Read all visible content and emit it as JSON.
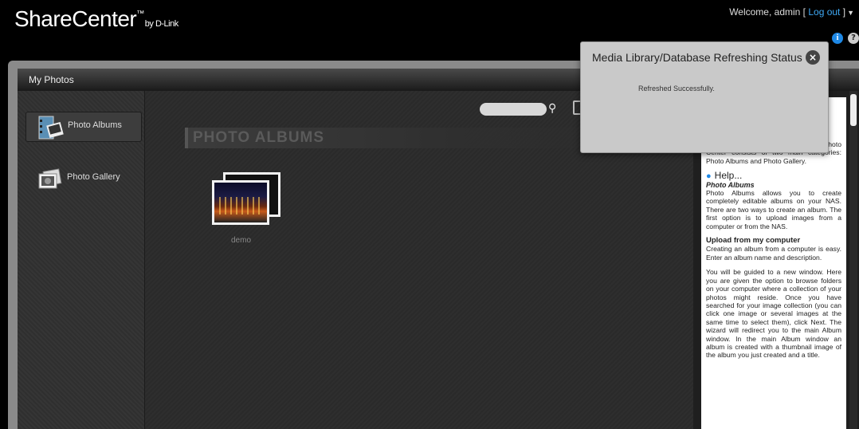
{
  "header": {
    "brand": "ShareCenter",
    "brand_tm": "™",
    "brand_by": "by D-Link",
    "welcome_text": "Welcome, admin [",
    "logout_label": "Log out",
    "welcome_end": "]",
    "info_icon": "info-icon",
    "help_icon": "help-icon"
  },
  "window": {
    "title": "My Photos"
  },
  "sidebar": {
    "items": [
      {
        "label": "Photo Albums",
        "icon": "photo-albums-icon",
        "active": true
      },
      {
        "label": "Photo Gallery",
        "icon": "photo-gallery-icon",
        "active": false
      }
    ]
  },
  "main": {
    "search_placeholder": "",
    "section_title": "PHOTO ALBUMS",
    "albums": [
      {
        "name": "demo"
      }
    ]
  },
  "help": {
    "intro_visible": "allows um on \"My e main enter. Photo Center consists of two main categories: Photo Albums and Photo Gallery.",
    "help_heading": "Help...",
    "photo_albums_title": "Photo Albums",
    "photo_albums_text": "Photo Albums allows you to create completely editable albums on your NAS. There are two ways to create an album. The first option is to upload images from a computer or from the NAS.",
    "upload_title": "Upload from my computer",
    "upload_text": "Creating an album from a computer is easy. Enter an album name and description.",
    "guide_text": "You will be guided to a new window. Here you are given the option to browse folders on your computer where a collection of your photos might reside. Once you have searched for your image collection (you can click one image or several images at the same time to select them), click Next. The wizard will redirect you to the main Album window. In the main Album window an album is created with a thumbnail image of the album you just created and a title."
  },
  "dialog": {
    "title": "Media Library/Database Refreshing Status",
    "message": "Refreshed Successfully."
  },
  "colors": {
    "accent": "#3fa9f5",
    "info": "#1e88e5"
  }
}
